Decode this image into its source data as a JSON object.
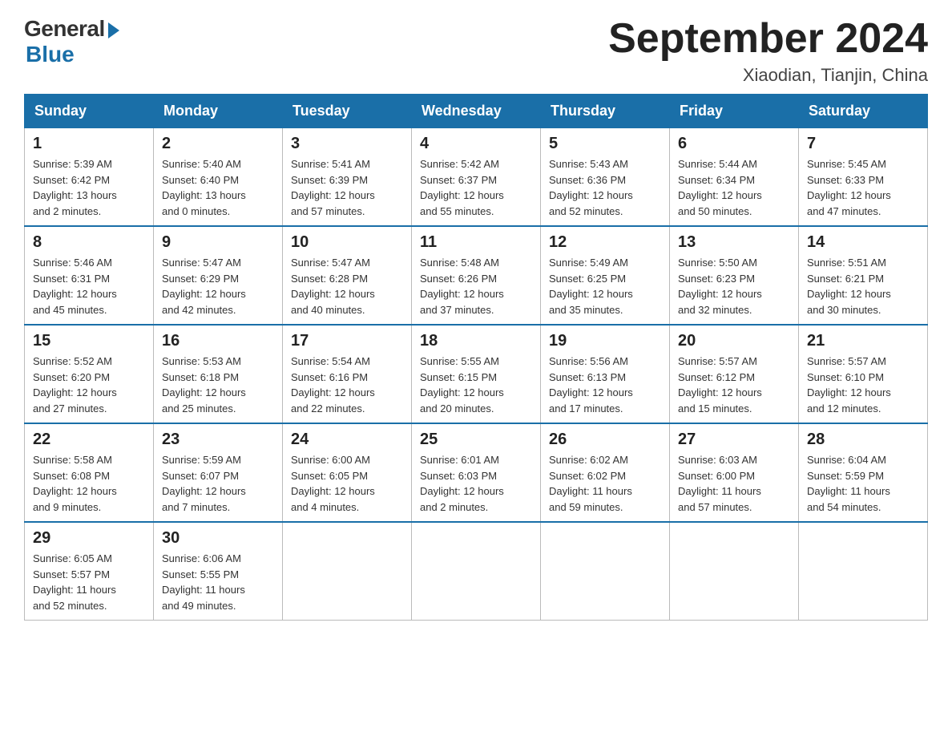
{
  "header": {
    "logo_general": "General",
    "logo_blue": "Blue",
    "month_title": "September 2024",
    "location": "Xiaodian, Tianjin, China"
  },
  "weekdays": [
    "Sunday",
    "Monday",
    "Tuesday",
    "Wednesday",
    "Thursday",
    "Friday",
    "Saturday"
  ],
  "weeks": [
    [
      {
        "day": "1",
        "sunrise": "5:39 AM",
        "sunset": "6:42 PM",
        "daylight": "13 hours and 2 minutes."
      },
      {
        "day": "2",
        "sunrise": "5:40 AM",
        "sunset": "6:40 PM",
        "daylight": "13 hours and 0 minutes."
      },
      {
        "day": "3",
        "sunrise": "5:41 AM",
        "sunset": "6:39 PM",
        "daylight": "12 hours and 57 minutes."
      },
      {
        "day": "4",
        "sunrise": "5:42 AM",
        "sunset": "6:37 PM",
        "daylight": "12 hours and 55 minutes."
      },
      {
        "day": "5",
        "sunrise": "5:43 AM",
        "sunset": "6:36 PM",
        "daylight": "12 hours and 52 minutes."
      },
      {
        "day": "6",
        "sunrise": "5:44 AM",
        "sunset": "6:34 PM",
        "daylight": "12 hours and 50 minutes."
      },
      {
        "day": "7",
        "sunrise": "5:45 AM",
        "sunset": "6:33 PM",
        "daylight": "12 hours and 47 minutes."
      }
    ],
    [
      {
        "day": "8",
        "sunrise": "5:46 AM",
        "sunset": "6:31 PM",
        "daylight": "12 hours and 45 minutes."
      },
      {
        "day": "9",
        "sunrise": "5:47 AM",
        "sunset": "6:29 PM",
        "daylight": "12 hours and 42 minutes."
      },
      {
        "day": "10",
        "sunrise": "5:47 AM",
        "sunset": "6:28 PM",
        "daylight": "12 hours and 40 minutes."
      },
      {
        "day": "11",
        "sunrise": "5:48 AM",
        "sunset": "6:26 PM",
        "daylight": "12 hours and 37 minutes."
      },
      {
        "day": "12",
        "sunrise": "5:49 AM",
        "sunset": "6:25 PM",
        "daylight": "12 hours and 35 minutes."
      },
      {
        "day": "13",
        "sunrise": "5:50 AM",
        "sunset": "6:23 PM",
        "daylight": "12 hours and 32 minutes."
      },
      {
        "day": "14",
        "sunrise": "5:51 AM",
        "sunset": "6:21 PM",
        "daylight": "12 hours and 30 minutes."
      }
    ],
    [
      {
        "day": "15",
        "sunrise": "5:52 AM",
        "sunset": "6:20 PM",
        "daylight": "12 hours and 27 minutes."
      },
      {
        "day": "16",
        "sunrise": "5:53 AM",
        "sunset": "6:18 PM",
        "daylight": "12 hours and 25 minutes."
      },
      {
        "day": "17",
        "sunrise": "5:54 AM",
        "sunset": "6:16 PM",
        "daylight": "12 hours and 22 minutes."
      },
      {
        "day": "18",
        "sunrise": "5:55 AM",
        "sunset": "6:15 PM",
        "daylight": "12 hours and 20 minutes."
      },
      {
        "day": "19",
        "sunrise": "5:56 AM",
        "sunset": "6:13 PM",
        "daylight": "12 hours and 17 minutes."
      },
      {
        "day": "20",
        "sunrise": "5:57 AM",
        "sunset": "6:12 PM",
        "daylight": "12 hours and 15 minutes."
      },
      {
        "day": "21",
        "sunrise": "5:57 AM",
        "sunset": "6:10 PM",
        "daylight": "12 hours and 12 minutes."
      }
    ],
    [
      {
        "day": "22",
        "sunrise": "5:58 AM",
        "sunset": "6:08 PM",
        "daylight": "12 hours and 9 minutes."
      },
      {
        "day": "23",
        "sunrise": "5:59 AM",
        "sunset": "6:07 PM",
        "daylight": "12 hours and 7 minutes."
      },
      {
        "day": "24",
        "sunrise": "6:00 AM",
        "sunset": "6:05 PM",
        "daylight": "12 hours and 4 minutes."
      },
      {
        "day": "25",
        "sunrise": "6:01 AM",
        "sunset": "6:03 PM",
        "daylight": "12 hours and 2 minutes."
      },
      {
        "day": "26",
        "sunrise": "6:02 AM",
        "sunset": "6:02 PM",
        "daylight": "11 hours and 59 minutes."
      },
      {
        "day": "27",
        "sunrise": "6:03 AM",
        "sunset": "6:00 PM",
        "daylight": "11 hours and 57 minutes."
      },
      {
        "day": "28",
        "sunrise": "6:04 AM",
        "sunset": "5:59 PM",
        "daylight": "11 hours and 54 minutes."
      }
    ],
    [
      {
        "day": "29",
        "sunrise": "6:05 AM",
        "sunset": "5:57 PM",
        "daylight": "11 hours and 52 minutes."
      },
      {
        "day": "30",
        "sunrise": "6:06 AM",
        "sunset": "5:55 PM",
        "daylight": "11 hours and 49 minutes."
      },
      null,
      null,
      null,
      null,
      null
    ]
  ],
  "labels": {
    "sunrise": "Sunrise:",
    "sunset": "Sunset:",
    "daylight": "Daylight:"
  }
}
